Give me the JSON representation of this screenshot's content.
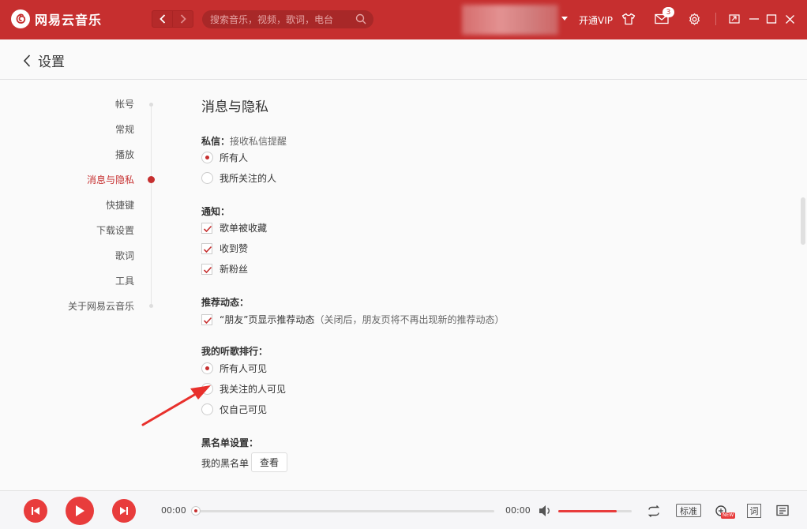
{
  "titlebar": {
    "app_name": "网易云音乐",
    "search_placeholder": "搜索音乐，视频，歌词，电台",
    "vip_label": "开通VIP",
    "message_count": "3"
  },
  "header": {
    "title": "设置"
  },
  "sidebar": {
    "items": [
      {
        "label": "帐号"
      },
      {
        "label": "常规"
      },
      {
        "label": "播放"
      },
      {
        "label": "消息与隐私"
      },
      {
        "label": "快捷键"
      },
      {
        "label": "下载设置"
      },
      {
        "label": "歌词"
      },
      {
        "label": "工具"
      },
      {
        "label": "关于网易云音乐"
      }
    ],
    "active_index": 3
  },
  "content": {
    "section_title": "消息与隐私",
    "private_msg": {
      "label": "私信：",
      "sub_label": "接收私信提醒",
      "options": [
        "所有人",
        "我所关注的人"
      ],
      "selected": 0
    },
    "notify": {
      "label": "通知：",
      "options": [
        "歌单被收藏",
        "收到赞",
        "新粉丝"
      ]
    },
    "recommend": {
      "label": "推荐动态：",
      "option": "“朋友”页显示推荐动态",
      "hint": "（关闭后，朋友页将不再出现新的推荐动态）"
    },
    "ranking": {
      "label": "我的听歌排行：",
      "options": [
        "所有人可见",
        "我关注的人可见",
        "仅自己可见"
      ],
      "selected": 0
    },
    "blacklist": {
      "label": "黑名单设置：",
      "text": "我的黑名单",
      "button": "查看"
    }
  },
  "player": {
    "time_current": "00:00",
    "time_total": "00:00",
    "progress": 0,
    "volume": 0.8,
    "quality_label": "标准",
    "new_tag": "NEW",
    "lyric_label": "词"
  },
  "colors": {
    "brand": "#c62f2f",
    "accent": "#e83c3c"
  }
}
